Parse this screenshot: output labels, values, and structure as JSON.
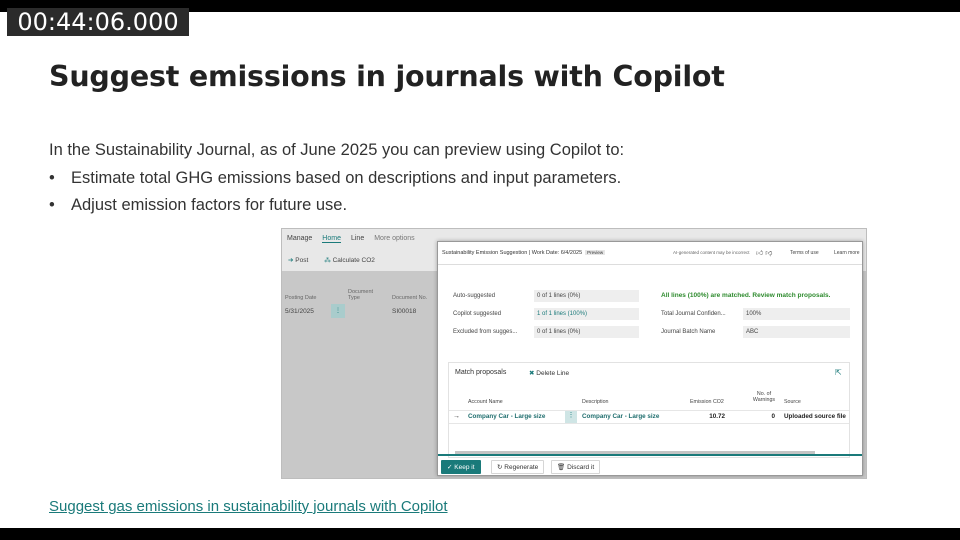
{
  "overlay": {
    "timestamp": "00:44:06.000"
  },
  "slide": {
    "title": "Suggest emissions in journals with Copilot",
    "intro": "In the Sustainability Journal, as of June 2025 you can preview using Copilot to:",
    "bullet_glyph": "•",
    "bullets": [
      "Estimate total GHG emissions based on descriptions and input parameters.",
      "Adjust emission factors for future use."
    ],
    "link_text": "Suggest gas emissions in sustainability journals with Copilot"
  },
  "screenshot": {
    "ribbon": {
      "tabs": [
        "Manage",
        "Home",
        "Line",
        "More options"
      ],
      "actions": [
        "Post",
        "Calculate CO2"
      ]
    },
    "journal_grid": {
      "columns": [
        "Posting Date",
        "Document Type",
        "Document No."
      ],
      "row": {
        "posting_date": "5/31/2025",
        "document_no": "SI00018"
      }
    },
    "dialog": {
      "title": "Sustainability Emission Suggestion | Work Date: 6/4/2025",
      "badge": "Preview",
      "ai_notice": "AI-generated content may be incorrect",
      "terms": "Terms of use",
      "learn_more": "Learn more",
      "fields": {
        "auto_suggested_label": "Auto-suggested",
        "auto_suggested_value": "0 of 1 lines (0%)",
        "copilot_suggested_label": "Copilot suggested",
        "copilot_suggested_value": "1 of 1 lines (100%)",
        "excluded_label": "Excluded from sugges...",
        "excluded_value": "0 of 1 lines (0%)",
        "matched_msg": "All lines (100%) are matched. Review match proposals.",
        "confidence_label": "Total Journal Confiden...",
        "confidence_value": "100%",
        "batch_label": "Journal Batch Name",
        "batch_value": "ABC"
      },
      "match_proposals": {
        "title": "Match proposals",
        "delete_line": "Delete Line",
        "columns": {
          "account_name": "Account Name",
          "description": "Description",
          "emission_co2": "Emission CO2",
          "no_warnings": "No. of Warnings",
          "source": "Source"
        },
        "row": {
          "account_name": "Company Car - Large size",
          "description": "Company Car - Large size",
          "emission_co2": "10.72",
          "no_warnings": "0",
          "source": "Uploaded source file"
        }
      },
      "footer": {
        "keep": "Keep it",
        "regenerate": "Regenerate",
        "discard": "Discard it"
      }
    }
  },
  "colors": {
    "accent": "#1a7a7a",
    "success": "#2e8b2e",
    "title_text": "#222222"
  },
  "icons": [
    "check-icon",
    "regenerate-icon",
    "trash-icon",
    "thumbs-up-icon",
    "thumbs-down-icon",
    "share-icon",
    "post-icon",
    "calculate-icon",
    "delete-icon",
    "row-arrow-icon"
  ]
}
